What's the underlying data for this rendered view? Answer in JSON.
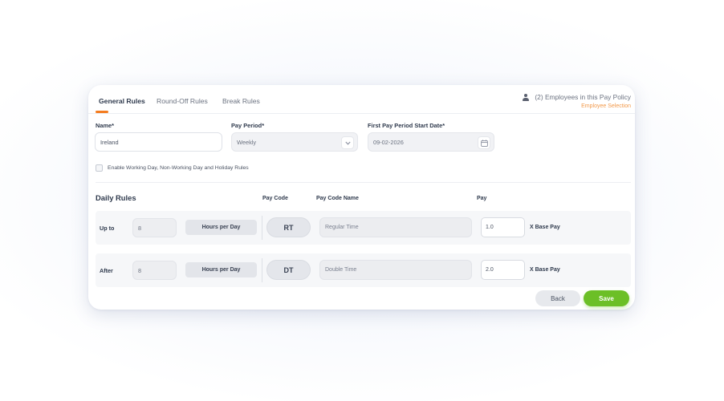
{
  "tabs": [
    {
      "label": "General Rules",
      "active": true
    },
    {
      "label": "Round-Off Rules",
      "active": false
    },
    {
      "label": "Break Rules",
      "active": false
    }
  ],
  "employees": {
    "summary": "(2) Employees in this Pay Policy",
    "link": "Employee Selection"
  },
  "form": {
    "name_label": "Name*",
    "name_value": "Ireland",
    "pay_period_label": "Pay Period*",
    "pay_period_value": "Weekly",
    "start_date_label": "First Pay Period Start Date*",
    "start_date_value": "09-02-2026",
    "checkbox_label": "Enable Working Day, Non-Working Day and Holiday Rules",
    "checkbox_checked": false
  },
  "daily_rules": {
    "title": "Daily Rules",
    "headers": {
      "pay_code": "Pay Code",
      "pay_code_name": "Pay Code Name",
      "pay": "Pay"
    },
    "rows": [
      {
        "label": "Up to",
        "hours": "8",
        "unit": "Hours per Day",
        "code": "RT",
        "code_name": "Regular Time",
        "pay": "1.0",
        "pay_unit": "X Base Pay"
      },
      {
        "label": "After",
        "hours": "8",
        "unit": "Hours per Day",
        "code": "DT",
        "code_name": "Double Time",
        "pay": "2.0",
        "pay_unit": "X Base Pay"
      }
    ]
  },
  "actions": {
    "back": "Back",
    "save": "Save"
  },
  "colors": {
    "accent": "#f47c20",
    "save": "#6cbf27",
    "link": "#f2994a"
  }
}
